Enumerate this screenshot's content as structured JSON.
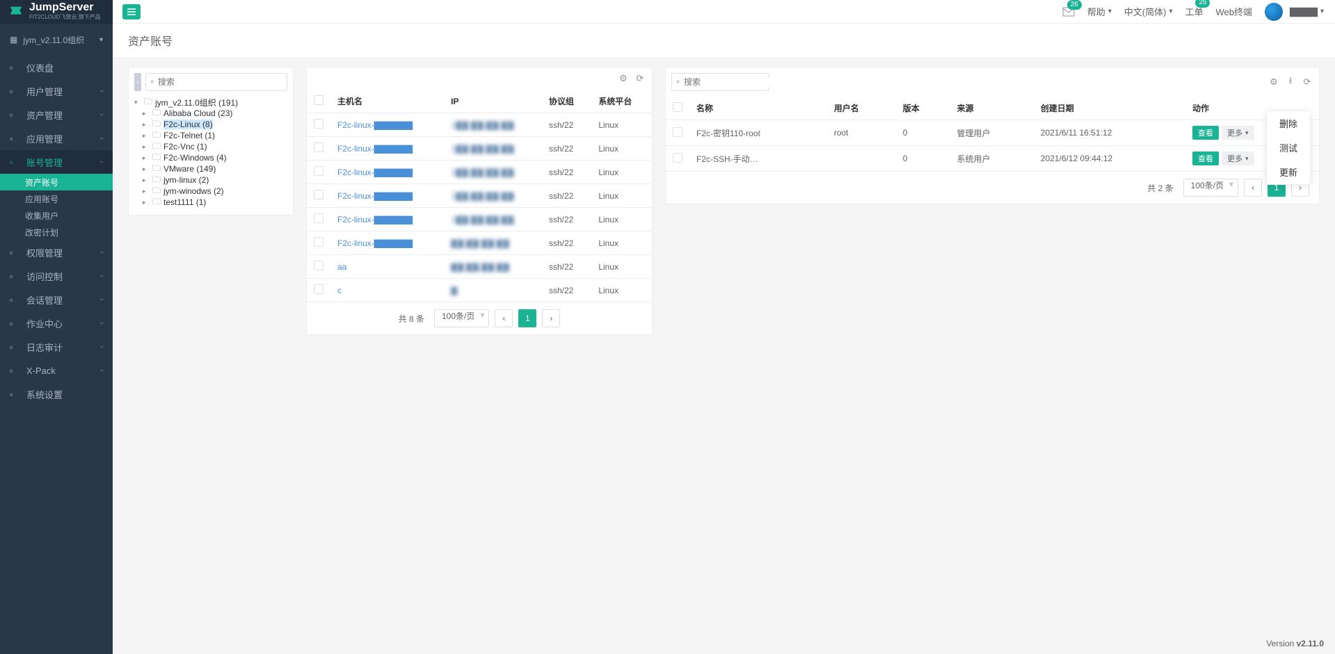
{
  "brand": {
    "name": "JumpServer",
    "sub": "FIT2CLOUD飞致云 旗下产品"
  },
  "header": {
    "mail_badge": "26",
    "help": "帮助",
    "lang": "中文(简体)",
    "ticket": "工单",
    "ticket_badge": "25",
    "web_terminal": "Web终端",
    "user_blur": "▇▇▇▇"
  },
  "org_name": "jym_v2.11.0组织",
  "nav": [
    {
      "icon": "dash",
      "label": "仪表盘",
      "sub": false
    },
    {
      "icon": "user",
      "label": "用户管理",
      "sub": true
    },
    {
      "icon": "asset",
      "label": "资产管理",
      "sub": true
    },
    {
      "icon": "app",
      "label": "应用管理",
      "sub": true
    },
    {
      "icon": "acct",
      "label": "账号管理",
      "sub": true,
      "open": true,
      "children": [
        {
          "label": "资产账号",
          "active": true
        },
        {
          "label": "应用账号"
        },
        {
          "label": "收集用户"
        },
        {
          "label": "改密计划"
        }
      ]
    },
    {
      "icon": "perm",
      "label": "权限管理",
      "sub": true
    },
    {
      "icon": "access",
      "label": "访问控制",
      "sub": true
    },
    {
      "icon": "sess",
      "label": "会话管理",
      "sub": true
    },
    {
      "icon": "job",
      "label": "作业中心",
      "sub": true
    },
    {
      "icon": "audit",
      "label": "日志审计",
      "sub": true
    },
    {
      "icon": "xpack",
      "label": "X-Pack",
      "sub": true
    },
    {
      "icon": "set",
      "label": "系统设置",
      "sub": false
    }
  ],
  "page_title": "资产账号",
  "search_placeholder": "搜索",
  "tree": [
    {
      "depth": 0,
      "caret": "▾",
      "label": "jym_v2.11.0组织 (191)"
    },
    {
      "depth": 1,
      "caret": "▸",
      "label": "Alibaba Cloud (23)"
    },
    {
      "depth": 1,
      "caret": "▸",
      "label": "F2c-Linux (8)",
      "selected": true
    },
    {
      "depth": 1,
      "caret": "▸",
      "label": "F2c-Telnet (1)"
    },
    {
      "depth": 1,
      "caret": "▸",
      "label": "F2c-Vnc (1)"
    },
    {
      "depth": 1,
      "caret": "▸",
      "label": "F2c-Windows (4)"
    },
    {
      "depth": 1,
      "caret": "▸",
      "label": "VMware (149)"
    },
    {
      "depth": 1,
      "caret": "▸",
      "label": "jym-linux (2)"
    },
    {
      "depth": 1,
      "caret": "▸",
      "label": "jym-winodws (2)"
    },
    {
      "depth": 1,
      "caret": "▸",
      "label": "test1111 (1)"
    }
  ],
  "hosts": {
    "columns": [
      "主机名",
      "IP",
      "协议组",
      "系统平台"
    ],
    "rows": [
      {
        "name": "F2c-linux-▇▇▇▇▇▇",
        "ip": "1▇▇.▇▇.▇▇.▇▇",
        "proto": "ssh/22",
        "os": "Linux"
      },
      {
        "name": "F2c-linux-▇▇▇▇▇▇",
        "ip": "1▇▇.▇▇.▇▇.▇▇",
        "proto": "ssh/22",
        "os": "Linux"
      },
      {
        "name": "F2c-linux-▇▇▇▇▇▇",
        "ip": "1▇▇.▇▇.▇▇.▇▇",
        "proto": "ssh/22",
        "os": "Linux"
      },
      {
        "name": "F2c-linux-▇▇▇▇▇▇",
        "ip": "1▇▇.▇▇.▇▇.▇▇",
        "proto": "ssh/22",
        "os": "Linux"
      },
      {
        "name": "F2c-linux-▇▇▇▇▇▇",
        "ip": "1▇▇.▇▇.▇▇.▇▇",
        "proto": "ssh/22",
        "os": "Linux"
      },
      {
        "name": "F2c-linux-▇▇▇▇▇▇",
        "ip": "▇▇.▇▇.▇▇.▇▇",
        "proto": "ssh/22",
        "os": "Linux"
      },
      {
        "name": "aa",
        "ip": "▇▇.▇▇.▇▇.▇▇",
        "proto": "ssh/22",
        "os": "Linux"
      },
      {
        "name": "c",
        "ip": "▇",
        "proto": "ssh/22",
        "os": "Linux"
      }
    ],
    "total": "共 8 条",
    "page_size": "100条/页",
    "page": "1"
  },
  "accounts": {
    "columns": [
      "名称",
      "用户名",
      "版本",
      "来源",
      "创建日期",
      "动作"
    ],
    "rows": [
      {
        "name": "F2c-密钥110-root",
        "user": "root",
        "ver": "0",
        "src": "管理用户",
        "date": "2021/6/11 16:51:12"
      },
      {
        "name": "F2c-SSH-手动…",
        "user": "",
        "ver": "0",
        "src": "系统用户",
        "date": "2021/6/12 09:44:12"
      }
    ],
    "view_label": "查看",
    "more_label": "更多",
    "total": "共 2 条",
    "page_size": "100条/页",
    "page": "1"
  },
  "dropdown": [
    "删除",
    "测试",
    "更新"
  ],
  "footer": {
    "prefix": "Version ",
    "ver": "v2.11.0"
  }
}
